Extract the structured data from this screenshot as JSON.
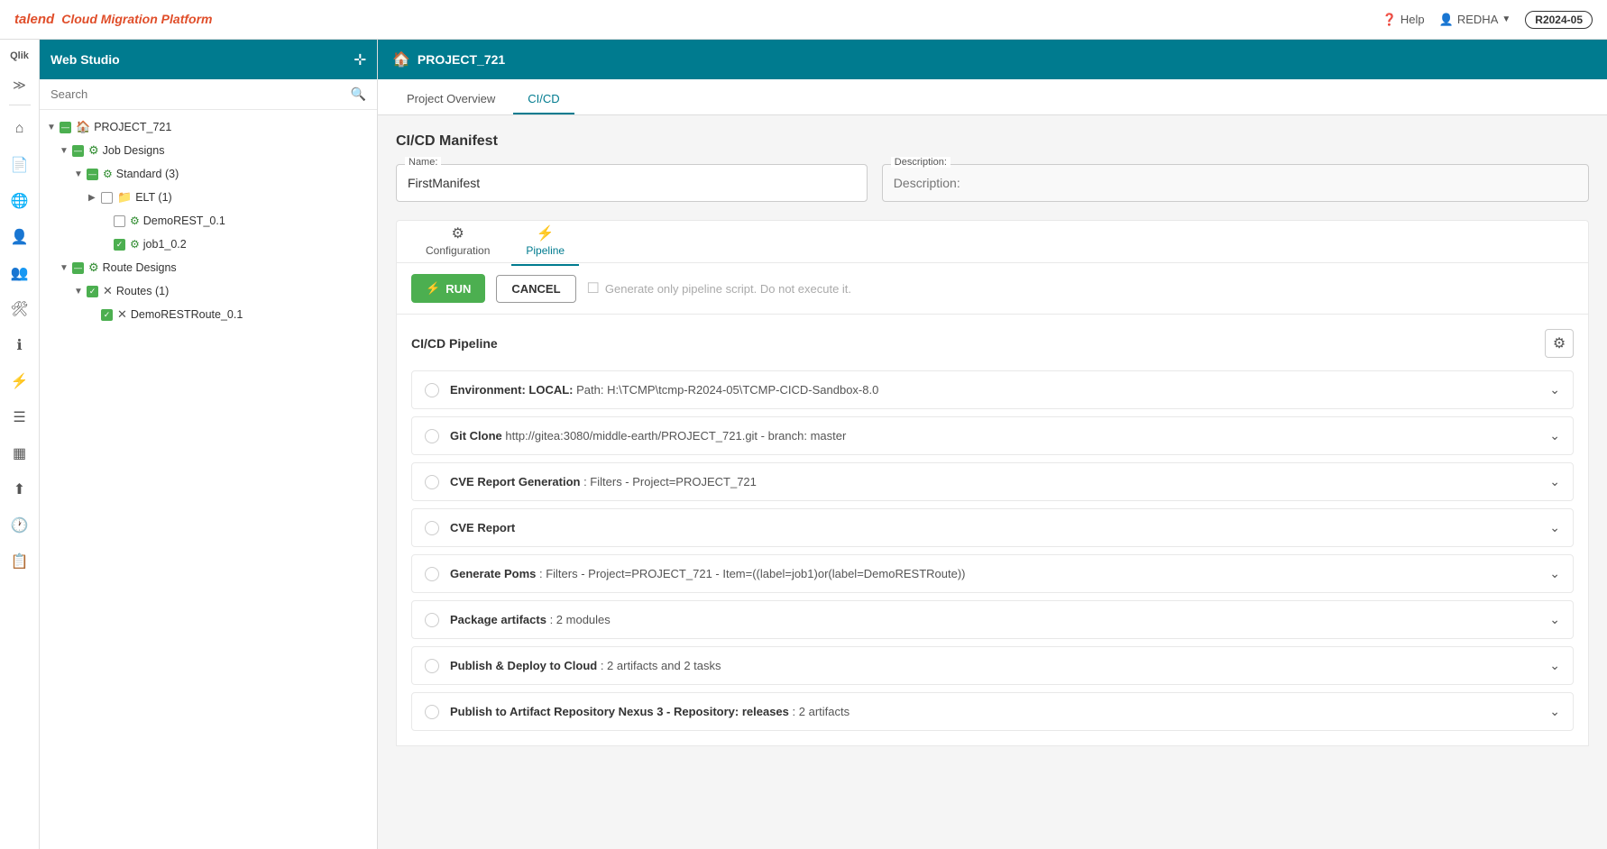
{
  "topbar": {
    "brand_talend": "talend",
    "brand_rest": "Cloud Migration Platform",
    "help_label": "Help",
    "user_label": "REDHA",
    "version_label": "R2024-05"
  },
  "sidebar": {
    "title": "Web Studio",
    "search_placeholder": "Search",
    "tree": [
      {
        "id": "project",
        "level": 0,
        "arrow": "▼",
        "check": "partial",
        "icon": "🏠",
        "label": "PROJECT_721",
        "type": "project"
      },
      {
        "id": "jobdesigns",
        "level": 1,
        "arrow": "▼",
        "check": "partial",
        "icon": "⚙",
        "label": "Job Designs",
        "type": "folder-green"
      },
      {
        "id": "standard",
        "level": 2,
        "arrow": "▼",
        "check": "partial",
        "icon": "⚙",
        "label": "Standard (3)",
        "type": "folder-green"
      },
      {
        "id": "elt",
        "level": 3,
        "arrow": "▶",
        "check": "none",
        "icon": "📁",
        "label": "ELT (1)",
        "type": "folder"
      },
      {
        "id": "demorest",
        "level": 3,
        "arrow": "",
        "check": "unchecked",
        "icon": "⚙",
        "label": "DemoREST_0.1",
        "type": "job"
      },
      {
        "id": "job1",
        "level": 3,
        "arrow": "",
        "check": "checked",
        "icon": "⚙",
        "label": "job1_0.2",
        "type": "job"
      },
      {
        "id": "routedesigns",
        "level": 1,
        "arrow": "▼",
        "check": "partial",
        "icon": "⚙",
        "label": "Route Designs",
        "type": "folder-green"
      },
      {
        "id": "routes",
        "level": 2,
        "arrow": "▼",
        "check": "checked",
        "icon": "✕",
        "label": "Routes (1)",
        "type": "routes"
      },
      {
        "id": "demorestroute",
        "level": 3,
        "arrow": "",
        "check": "checked",
        "icon": "✕",
        "label": "DemoRESTRoute_0.1",
        "type": "route"
      }
    ]
  },
  "project_header": {
    "icon": "🏠",
    "title": "PROJECT_721"
  },
  "tabs": [
    {
      "id": "project-overview",
      "label": "Project Overview",
      "active": false
    },
    {
      "id": "cicd",
      "label": "CI/CD",
      "active": true
    }
  ],
  "cicd": {
    "section_title": "CI/CD Manifest",
    "name_label": "Name:",
    "name_value": "FirstManifest",
    "description_label": "Description:",
    "description_value": "",
    "sub_tabs": [
      {
        "id": "configuration",
        "label": "Configuration",
        "icon": "⚙",
        "active": false
      },
      {
        "id": "pipeline",
        "label": "Pipeline",
        "icon": "⚡",
        "active": true
      }
    ],
    "run_button": "RUN",
    "cancel_button": "CANCEL",
    "generate_text": "Generate only pipeline script. Do not execute it.",
    "pipeline_section_title": "CI/CD Pipeline",
    "pipeline_items": [
      {
        "id": "env-local",
        "bold": "Environment: LOCAL:",
        "details": " Path: H:\\TCMP\\tcmp-R2024-05\\TCMP-CICD-Sandbox-8.0"
      },
      {
        "id": "git-clone",
        "bold": "Git Clone",
        "details": " http://gitea:3080/middle-earth/PROJECT_721.git - branch: master"
      },
      {
        "id": "cve-report-gen",
        "bold": "CVE Report Generation",
        "details": " : Filters - Project=PROJECT_721"
      },
      {
        "id": "cve-report",
        "bold": "CVE Report",
        "details": ""
      },
      {
        "id": "generate-poms",
        "bold": "Generate Poms",
        "details": " : Filters - Project=PROJECT_721 - Item=((label=job1)or(label=DemoRESTRoute))"
      },
      {
        "id": "package-artifacts",
        "bold": "Package artifacts",
        "details": " : 2 modules"
      },
      {
        "id": "publish-deploy",
        "bold": "Publish & Deploy to Cloud",
        "details": " : 2 artifacts and 2 tasks"
      },
      {
        "id": "publish-nexus",
        "bold": "Publish to Artifact Repository Nexus 3 - Repository: releases",
        "details": " : 2 artifacts"
      }
    ]
  },
  "icons": {
    "search": "🔍",
    "expand": "≫",
    "home": "⌂",
    "document": "📄",
    "globe": "🌐",
    "user": "👤",
    "users": "👥",
    "tools": "🛠",
    "info": "ℹ",
    "lightning": "⚡",
    "list": "☰",
    "grid": "▦",
    "upload": "⬆",
    "clock": "🕐",
    "report": "📋",
    "help": "❓",
    "gear": "⚙",
    "chevron_down": "⌄",
    "run": "⚡"
  }
}
